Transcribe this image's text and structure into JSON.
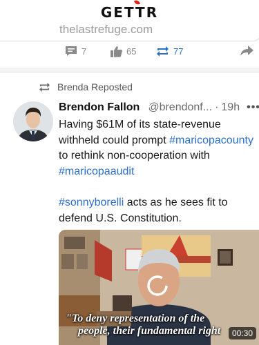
{
  "app": {
    "logo_text": "GETTR"
  },
  "previous_post": {
    "link_domain": "thelastrefuge.com",
    "actions": {
      "comments": "7",
      "likes": "65",
      "reposts": "77"
    }
  },
  "post": {
    "repost_label": "Brenda Reposted",
    "author_name": "Brendon Fallon",
    "handle": "@brendonf...",
    "separator": "·",
    "time": "19h",
    "more_label": "•••",
    "text": {
      "p1_a": "Having $61M of its state-revenue withheld could prompt ",
      "p1_tag1": "#maricopacounty",
      "p1_b": " to rethink non-cooperation with ",
      "p1_tag2": "#maricopaaudit",
      "p2_tag": "#sonnyborelli",
      "p2_text": " acts as he sees fit to defend U.S. Constitution."
    },
    "video": {
      "caption_line1": "\"To deny representation of the",
      "caption_line2": "people, their fundamental right",
      "duration": "00:30"
    }
  },
  "colors": {
    "link": "#2b6fc9",
    "brand_red": "#e2231a",
    "verified": "#c62828"
  }
}
